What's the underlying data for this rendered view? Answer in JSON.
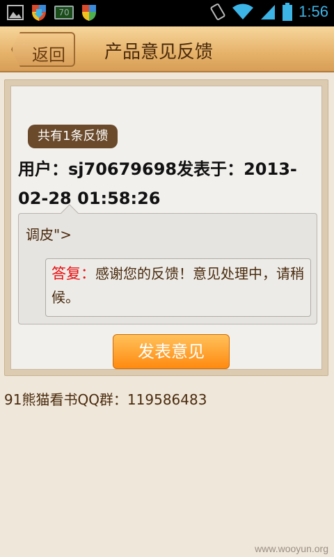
{
  "status_bar": {
    "battery_level": "70",
    "time": "1:56",
    "icons": [
      "image-icon",
      "download-shield-icon",
      "battery-badge-icon",
      "shield-icon",
      "rotate-icon",
      "wifi-icon",
      "signal-icon",
      "battery-icon"
    ]
  },
  "header": {
    "back_label": "返回",
    "title": "产品意见反馈"
  },
  "feedback": {
    "count_label": "共有1条反馈",
    "user_line": "用户：sj70679698发表于：2013-02-28 01:58:26",
    "comment": "调皮\">",
    "reply_label": "答复：",
    "reply_text": "感谢您的反馈！意见处理中，请稍候。",
    "submit_label": "发表意见"
  },
  "footer": {
    "qq_group": "91熊猫看书QQ群：119586483",
    "watermark": "www.wooyun.org"
  },
  "colors": {
    "header_bg": "#e6b26a",
    "reply_label": "#e81010",
    "button": "#ff8a10",
    "page_bg": "#efe7da"
  }
}
